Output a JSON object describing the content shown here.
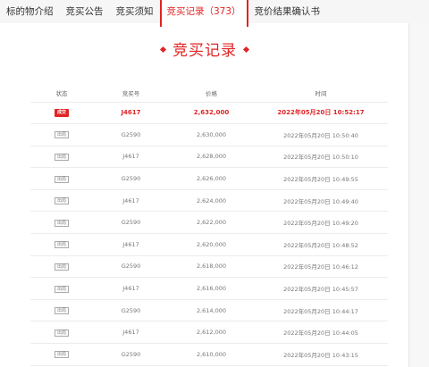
{
  "tabs": [
    {
      "label": "标的物介绍"
    },
    {
      "label": "竞买公告"
    },
    {
      "label": "竞买须知"
    },
    {
      "label": "竞买记录（373）"
    },
    {
      "label": "竞价结果确认书"
    }
  ],
  "heading": "竞买记录",
  "table": {
    "columns": [
      "状态",
      "竞买号",
      "价格",
      "时间"
    ],
    "rows": [
      {
        "status": "成交",
        "bidder": "J4617",
        "price": "2,632,000",
        "time": "2022年05月20日 10:52:17"
      },
      {
        "status": "出局",
        "bidder": "G2590",
        "price": "2,630,000",
        "time": "2022年05月20日 10:50:40"
      },
      {
        "status": "出局",
        "bidder": "J4617",
        "price": "2,628,000",
        "time": "2022年05月20日 10:50:10"
      },
      {
        "status": "出局",
        "bidder": "G2590",
        "price": "2,626,000",
        "time": "2022年05月20日 10:49:55"
      },
      {
        "status": "出局",
        "bidder": "J4617",
        "price": "2,624,000",
        "time": "2022年05月20日 10:49:40"
      },
      {
        "status": "出局",
        "bidder": "G2590",
        "price": "2,622,000",
        "time": "2022年05月20日 10:49:20"
      },
      {
        "status": "出局",
        "bidder": "J4617",
        "price": "2,620,000",
        "time": "2022年05月20日 10:48:52"
      },
      {
        "status": "出局",
        "bidder": "G2590",
        "price": "2,618,000",
        "time": "2022年05月20日 10:46:12"
      },
      {
        "status": "出局",
        "bidder": "J4617",
        "price": "2,616,000",
        "time": "2022年05月20日 10:45:57"
      },
      {
        "status": "出局",
        "bidder": "G2590",
        "price": "2,614,000",
        "time": "2022年05月20日 10:44:17"
      },
      {
        "status": "出局",
        "bidder": "J4617",
        "price": "2,612,000",
        "time": "2022年05月20日 10:44:05"
      },
      {
        "status": "出局",
        "bidder": "G2590",
        "price": "2,610,000",
        "time": "2022年05月20日 10:43:15"
      }
    ]
  },
  "colors": {
    "accent": "#e02424"
  }
}
